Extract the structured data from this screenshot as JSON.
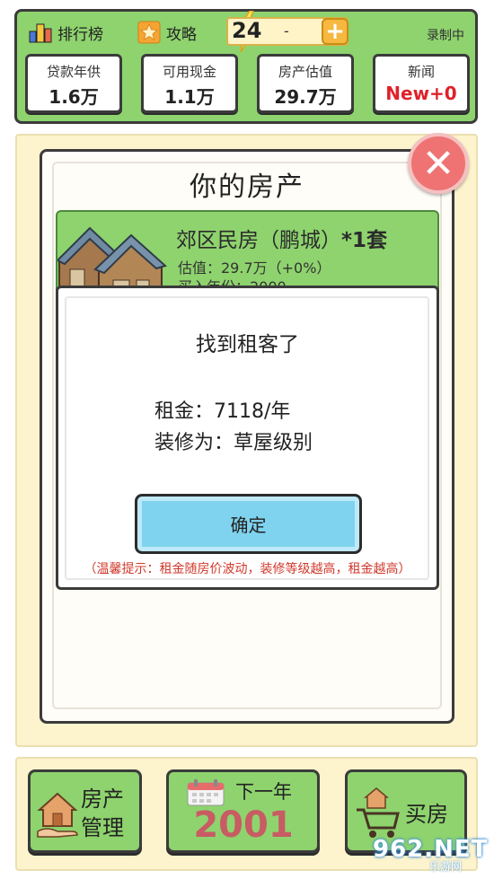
{
  "top": {
    "ranking_label": "排行榜",
    "guide_label": "攻略",
    "turn_value": "24",
    "turn_separator": "-",
    "plus_icon": "+",
    "recording_label": "录制中"
  },
  "stats": [
    {
      "label": "贷款年供",
      "value": "1.6万"
    },
    {
      "label": "可用现金",
      "value": "1.1万"
    },
    {
      "label": "房产估值",
      "value": "29.7万"
    },
    {
      "label": "新闻",
      "value": "New+0"
    }
  ],
  "panel": {
    "title": "你的房产",
    "close_icon": "✕",
    "property": {
      "name": "郊区民房（鹏城）",
      "count": "*1套",
      "valuation": "估值：29.7万（+0%）",
      "buy_year": "买入年份：2000"
    }
  },
  "dialog": {
    "title": "找到租客了",
    "rent": "租金：7118/年",
    "decoration": "装修为：草屋级别",
    "ok_label": "确定",
    "tip": "（温馨提示：租金随房价波动，装修等级越高，租金越高）"
  },
  "bottom": {
    "manage_line1": "房产",
    "manage_line2": "管理",
    "next_year_label": "下一年",
    "year_value": "2001",
    "buy_label": "买房"
  },
  "watermark": {
    "main": "962.NET",
    "sub": "乐游网"
  },
  "colors": {
    "green": "#8ed36e",
    "cream": "#fdf3cd",
    "red_text": "#e0202a",
    "button_blue": "#7fd3ee"
  }
}
